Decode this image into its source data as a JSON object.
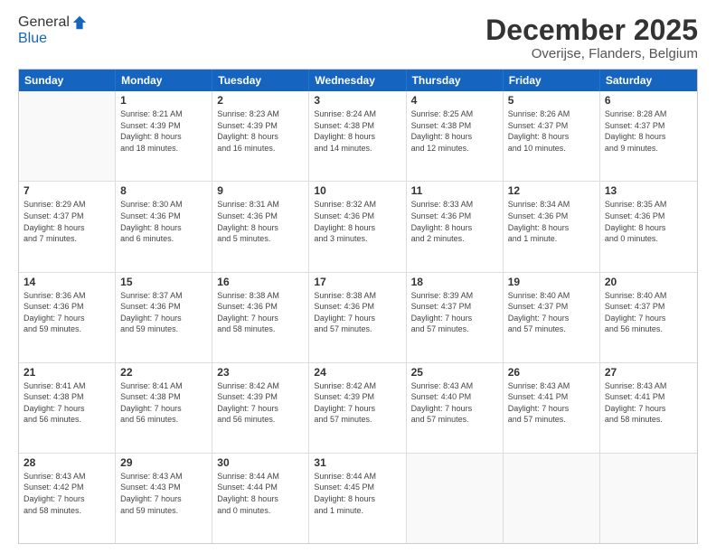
{
  "logo": {
    "general": "General",
    "blue": "Blue"
  },
  "title": "December 2025",
  "location": "Overijse, Flanders, Belgium",
  "days": [
    "Sunday",
    "Monday",
    "Tuesday",
    "Wednesday",
    "Thursday",
    "Friday",
    "Saturday"
  ],
  "weeks": [
    [
      {
        "day": "",
        "info": ""
      },
      {
        "day": "1",
        "info": "Sunrise: 8:21 AM\nSunset: 4:39 PM\nDaylight: 8 hours\nand 18 minutes."
      },
      {
        "day": "2",
        "info": "Sunrise: 8:23 AM\nSunset: 4:39 PM\nDaylight: 8 hours\nand 16 minutes."
      },
      {
        "day": "3",
        "info": "Sunrise: 8:24 AM\nSunset: 4:38 PM\nDaylight: 8 hours\nand 14 minutes."
      },
      {
        "day": "4",
        "info": "Sunrise: 8:25 AM\nSunset: 4:38 PM\nDaylight: 8 hours\nand 12 minutes."
      },
      {
        "day": "5",
        "info": "Sunrise: 8:26 AM\nSunset: 4:37 PM\nDaylight: 8 hours\nand 10 minutes."
      },
      {
        "day": "6",
        "info": "Sunrise: 8:28 AM\nSunset: 4:37 PM\nDaylight: 8 hours\nand 9 minutes."
      }
    ],
    [
      {
        "day": "7",
        "info": "Sunrise: 8:29 AM\nSunset: 4:37 PM\nDaylight: 8 hours\nand 7 minutes."
      },
      {
        "day": "8",
        "info": "Sunrise: 8:30 AM\nSunset: 4:36 PM\nDaylight: 8 hours\nand 6 minutes."
      },
      {
        "day": "9",
        "info": "Sunrise: 8:31 AM\nSunset: 4:36 PM\nDaylight: 8 hours\nand 5 minutes."
      },
      {
        "day": "10",
        "info": "Sunrise: 8:32 AM\nSunset: 4:36 PM\nDaylight: 8 hours\nand 3 minutes."
      },
      {
        "day": "11",
        "info": "Sunrise: 8:33 AM\nSunset: 4:36 PM\nDaylight: 8 hours\nand 2 minutes."
      },
      {
        "day": "12",
        "info": "Sunrise: 8:34 AM\nSunset: 4:36 PM\nDaylight: 8 hours\nand 1 minute."
      },
      {
        "day": "13",
        "info": "Sunrise: 8:35 AM\nSunset: 4:36 PM\nDaylight: 8 hours\nand 0 minutes."
      }
    ],
    [
      {
        "day": "14",
        "info": "Sunrise: 8:36 AM\nSunset: 4:36 PM\nDaylight: 7 hours\nand 59 minutes."
      },
      {
        "day": "15",
        "info": "Sunrise: 8:37 AM\nSunset: 4:36 PM\nDaylight: 7 hours\nand 59 minutes."
      },
      {
        "day": "16",
        "info": "Sunrise: 8:38 AM\nSunset: 4:36 PM\nDaylight: 7 hours\nand 58 minutes."
      },
      {
        "day": "17",
        "info": "Sunrise: 8:38 AM\nSunset: 4:36 PM\nDaylight: 7 hours\nand 57 minutes."
      },
      {
        "day": "18",
        "info": "Sunrise: 8:39 AM\nSunset: 4:37 PM\nDaylight: 7 hours\nand 57 minutes."
      },
      {
        "day": "19",
        "info": "Sunrise: 8:40 AM\nSunset: 4:37 PM\nDaylight: 7 hours\nand 57 minutes."
      },
      {
        "day": "20",
        "info": "Sunrise: 8:40 AM\nSunset: 4:37 PM\nDaylight: 7 hours\nand 56 minutes."
      }
    ],
    [
      {
        "day": "21",
        "info": "Sunrise: 8:41 AM\nSunset: 4:38 PM\nDaylight: 7 hours\nand 56 minutes."
      },
      {
        "day": "22",
        "info": "Sunrise: 8:41 AM\nSunset: 4:38 PM\nDaylight: 7 hours\nand 56 minutes."
      },
      {
        "day": "23",
        "info": "Sunrise: 8:42 AM\nSunset: 4:39 PM\nDaylight: 7 hours\nand 56 minutes."
      },
      {
        "day": "24",
        "info": "Sunrise: 8:42 AM\nSunset: 4:39 PM\nDaylight: 7 hours\nand 57 minutes."
      },
      {
        "day": "25",
        "info": "Sunrise: 8:43 AM\nSunset: 4:40 PM\nDaylight: 7 hours\nand 57 minutes."
      },
      {
        "day": "26",
        "info": "Sunrise: 8:43 AM\nSunset: 4:41 PM\nDaylight: 7 hours\nand 57 minutes."
      },
      {
        "day": "27",
        "info": "Sunrise: 8:43 AM\nSunset: 4:41 PM\nDaylight: 7 hours\nand 58 minutes."
      }
    ],
    [
      {
        "day": "28",
        "info": "Sunrise: 8:43 AM\nSunset: 4:42 PM\nDaylight: 7 hours\nand 58 minutes."
      },
      {
        "day": "29",
        "info": "Sunrise: 8:43 AM\nSunset: 4:43 PM\nDaylight: 7 hours\nand 59 minutes."
      },
      {
        "day": "30",
        "info": "Sunrise: 8:44 AM\nSunset: 4:44 PM\nDaylight: 8 hours\nand 0 minutes."
      },
      {
        "day": "31",
        "info": "Sunrise: 8:44 AM\nSunset: 4:45 PM\nDaylight: 8 hours\nand 1 minute."
      },
      {
        "day": "",
        "info": ""
      },
      {
        "day": "",
        "info": ""
      },
      {
        "day": "",
        "info": ""
      }
    ]
  ]
}
